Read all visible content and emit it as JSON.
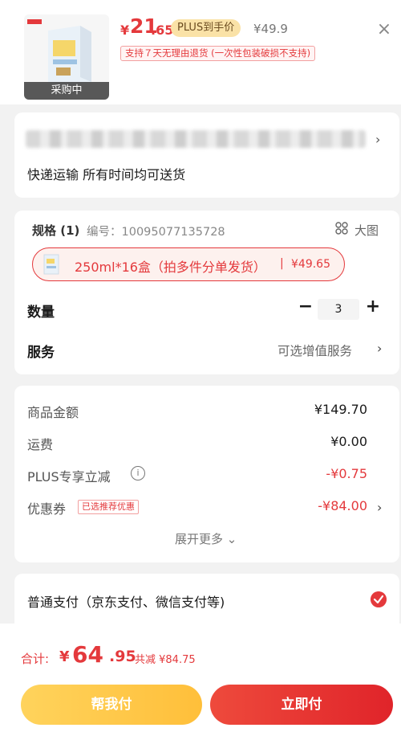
{
  "product": {
    "thumb_caption": "采购中",
    "price_currency": "¥",
    "price_int": "21",
    "price_dec": ".65",
    "plus_tag": "PLUS到手价",
    "original_price": "¥49.9",
    "return_policy": "支持７天无理由退货 (一次性包装破损不支持)"
  },
  "address": {
    "delivery_text": "快递运输 所有时间均可送货"
  },
  "spec": {
    "title": "规格 (1)",
    "code": "编号：10095077135728",
    "big_image_label": "大图",
    "selected_option": {
      "name": "250ml*16盒（拍多件分单发货）",
      "separator": "|",
      "price": "¥49.65"
    },
    "quantity_label": "数量",
    "minus": "−",
    "quantity": "3",
    "plus": "+",
    "service_label": "服务",
    "service_value": "可选增值服务"
  },
  "summary": {
    "rows": [
      {
        "label": "商品金额",
        "value": "¥149.70"
      },
      {
        "label": "运费",
        "value": "¥0.00"
      },
      {
        "label": "PLUS专享立减",
        "value": "-¥0.75"
      },
      {
        "label": "优惠券",
        "value": "-¥84.00"
      }
    ],
    "coupon_badge": "已选推荐优惠",
    "expand_more": "展开更多"
  },
  "payment": {
    "method": "普通支付（京东支付、微信支付等)"
  },
  "footer": {
    "total_label": "合计:",
    "total_currency": "¥",
    "total_int": "64",
    "total_dec": ".95",
    "total_discount": "共减 ¥84.75",
    "help_pay_button": "帮我付",
    "submit_button": "立即付"
  },
  "colors": {
    "accent_red": "#e4393c",
    "plus_gold": "#fae2a7",
    "help_button": "#ffc94a"
  }
}
